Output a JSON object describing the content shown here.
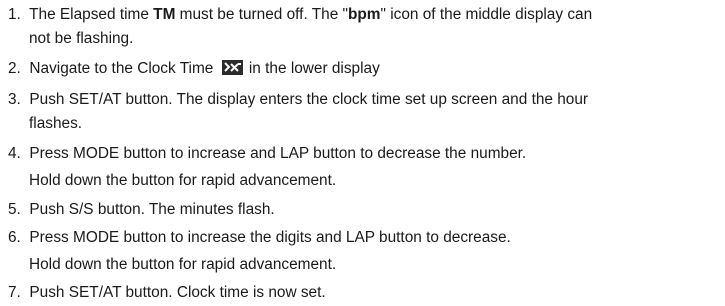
{
  "steps": [
    {
      "num": "1.",
      "t1": "The Elapsed time ",
      "t1b": "TM",
      "t2": " must be turned off. The \"",
      "t2b": "bpm",
      "t3": "\" icon of the middle display can",
      "cont": "not be flashing."
    },
    {
      "num": "2.",
      "before": "Navigate to the Clock Time",
      "icon": "clock-time-icon",
      "after": "in the lower display"
    },
    {
      "num": "3.",
      "text": "Push SET/AT button. The display enters the clock time set up screen and the hour",
      "cont": "flashes."
    },
    {
      "num": "4.",
      "text": "Press MODE button to increase and LAP button to decrease the number.",
      "cont": "Hold down the button for rapid advancement."
    },
    {
      "num": "5.",
      "text": "Push S/S button. The minutes flash."
    },
    {
      "num": "6.",
      "text": "Press MODE button to increase the digits and LAP button to decrease.",
      "cont": "Hold down the button for rapid advancement."
    },
    {
      "num": "7.",
      "text": "Push SET/AT button. Clock time is now set."
    }
  ]
}
